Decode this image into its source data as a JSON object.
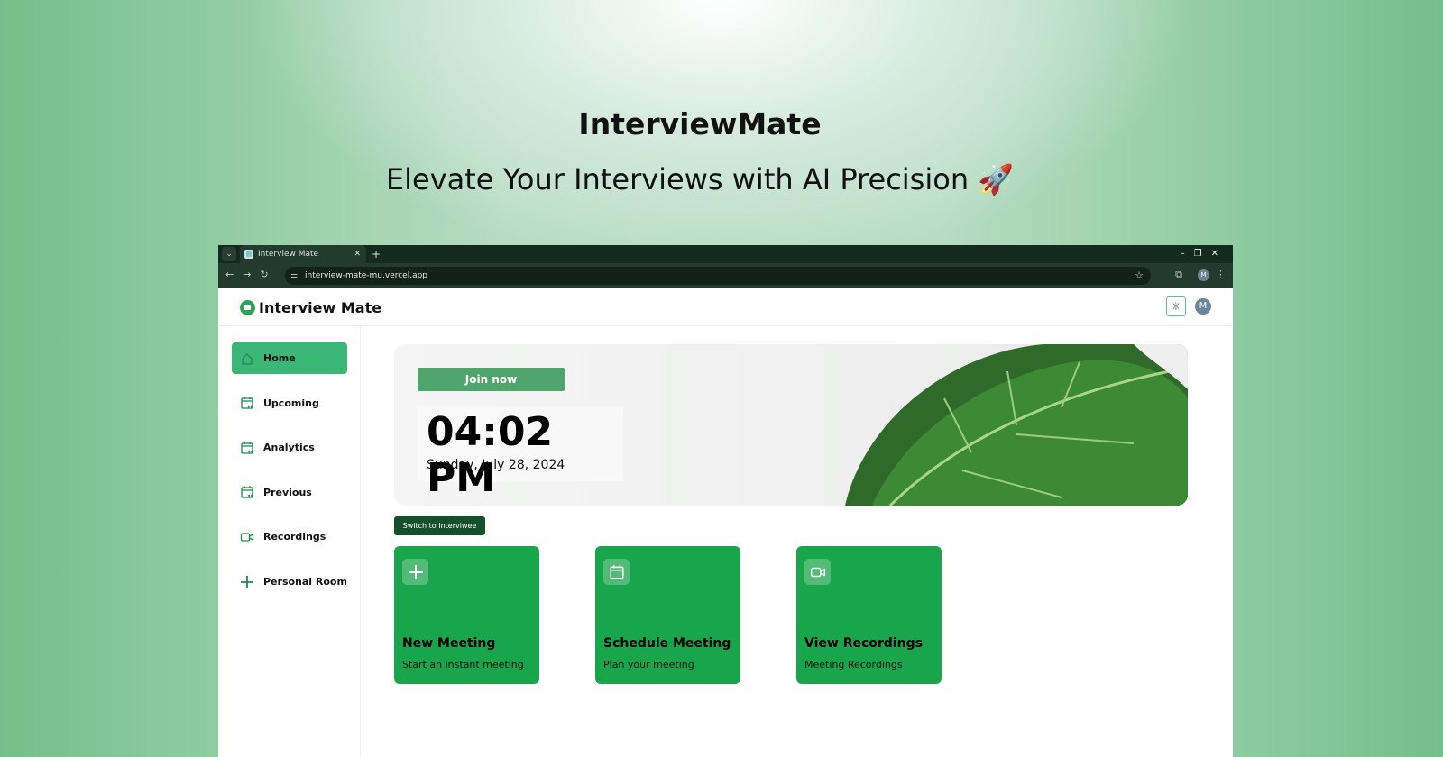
{
  "hero": {
    "title": "InterviewMate",
    "subtitle": "Elevate Your Interviews with AI Precision 🚀"
  },
  "browser": {
    "tab_title": "Interview Mate",
    "url": "interview-mate-mu.vercel.app",
    "profile_initial": "M"
  },
  "app": {
    "logo_text": "Interview Mate",
    "avatar_initial": "M",
    "sidebar": [
      {
        "label": "Home",
        "icon": "home-icon",
        "active": true
      },
      {
        "label": "Upcoming",
        "icon": "calendar-forward-icon"
      },
      {
        "label": "Analytics",
        "icon": "calendar-back-icon"
      },
      {
        "label": "Previous",
        "icon": "calendar-back-icon"
      },
      {
        "label": "Recordings",
        "icon": "video-icon"
      },
      {
        "label": "Personal Room",
        "icon": "plus-icon"
      }
    ],
    "banner": {
      "join_label": "Join now",
      "time": "04:02 PM",
      "date": "Sunday, July 28, 2024"
    },
    "switch_label": "Switch to Interviwee",
    "cards": [
      {
        "title": "New Meeting",
        "subtitle": "Start an instant meeting",
        "icon": "plus-icon"
      },
      {
        "title": "Schedule Meeting",
        "subtitle": "Plan your meeting",
        "icon": "calendar-icon"
      },
      {
        "title": "View Recordings",
        "subtitle": "Meeting Recordings",
        "icon": "video-icon"
      }
    ]
  },
  "colors": {
    "primary": "#18a54b",
    "active_nav": "#3ab777",
    "dark_button": "#15502c"
  }
}
